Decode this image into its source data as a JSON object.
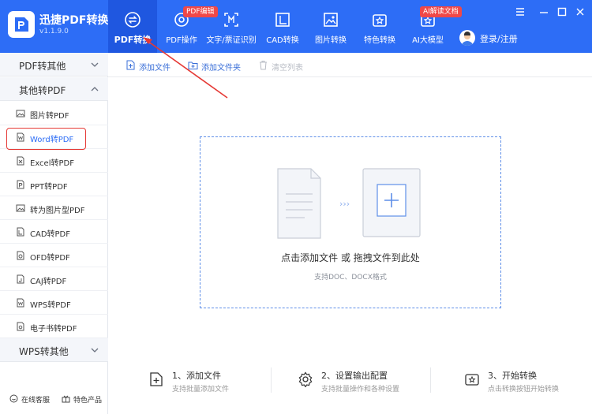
{
  "app": {
    "name": "迅捷PDF转换器",
    "version": "v1.1.9.0"
  },
  "nav": [
    {
      "label": "PDF转换",
      "icon": "convert-icon",
      "active": true
    },
    {
      "label": "PDF操作",
      "icon": "pdf-operate-icon",
      "badge": "PDF编辑"
    },
    {
      "label": "文字/票证识别",
      "icon": "ocr-icon"
    },
    {
      "label": "CAD转换",
      "icon": "cad-icon"
    },
    {
      "label": "图片转换",
      "icon": "image-icon"
    },
    {
      "label": "特色转换",
      "icon": "special-icon"
    },
    {
      "label": "AI大模型",
      "icon": "ai-icon",
      "badge": "AI解读文档"
    }
  ],
  "login": {
    "label": "登录/注册"
  },
  "sidebar": {
    "categories": [
      {
        "label": "PDF转其他",
        "expanded": false
      },
      {
        "label": "其他转PDF",
        "expanded": true
      },
      {
        "label": "WPS转其他",
        "expanded": false
      }
    ],
    "items": [
      {
        "label": "图片转PDF",
        "icon": "image-file-icon"
      },
      {
        "label": "Word转PDF",
        "icon": "word-file-icon",
        "active": true
      },
      {
        "label": "Excel转PDF",
        "icon": "excel-file-icon"
      },
      {
        "label": "PPT转PDF",
        "icon": "ppt-file-icon"
      },
      {
        "label": "转为图片型PDF",
        "icon": "image-pdf-icon"
      },
      {
        "label": "CAD转PDF",
        "icon": "cad-file-icon"
      },
      {
        "label": "OFD转PDF",
        "icon": "ofd-file-icon"
      },
      {
        "label": "CAJ转PDF",
        "icon": "caj-file-icon"
      },
      {
        "label": "WPS转PDF",
        "icon": "wps-file-icon"
      },
      {
        "label": "电子书转PDF",
        "icon": "ebook-file-icon"
      }
    ],
    "bottom": {
      "service": "在线客服",
      "featured": "特色产品"
    }
  },
  "toolbar": {
    "add_file": "添加文件",
    "add_folder": "添加文件夹",
    "clear_list": "清空列表"
  },
  "dropzone": {
    "main_text": "点击添加文件 或 拖拽文件到此处",
    "sub_text": "支持DOC、DOCX格式"
  },
  "steps": [
    {
      "title": "1、添加文件",
      "desc": "支持批量添加文件",
      "icon": "add-file-icon"
    },
    {
      "title": "2、设置输出配置",
      "desc": "支持批量操作和各种设置",
      "icon": "settings-icon"
    },
    {
      "title": "3、开始转换",
      "desc": "点击转换按钮开始转换",
      "icon": "convert-start-icon"
    }
  ],
  "colors": {
    "brand": "#2d6df6",
    "badge": "#f04848",
    "annotation": "#e53935"
  }
}
